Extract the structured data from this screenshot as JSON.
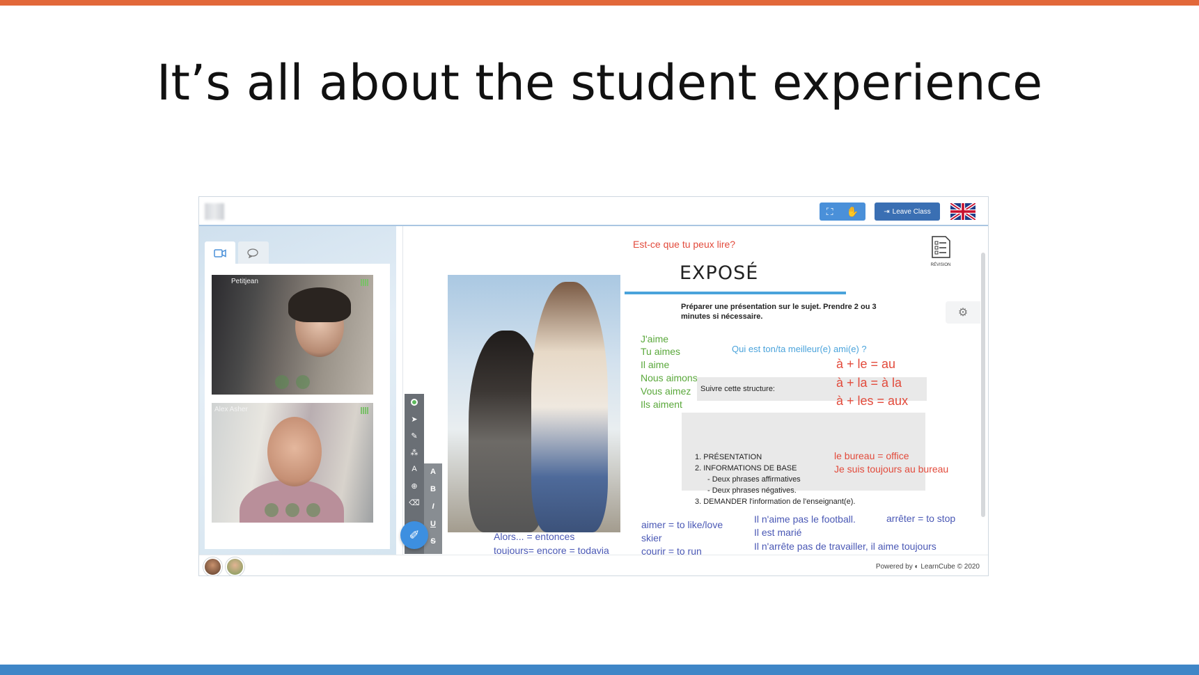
{
  "slide": {
    "title": "It’s all about the student experience",
    "colors": {
      "top_bar": "#e2683a",
      "bottom_bar": "#3f86c7"
    }
  },
  "app": {
    "header": {
      "fullscreen_icon": "fullscreen-icon",
      "hand_icon": "hand-raise-icon",
      "leave_label": "Leave Class",
      "leave_icon": "exit-icon",
      "flag_icon": "uk-flag-icon"
    },
    "left_panel": {
      "tabs": [
        {
          "icon": "video-camera-icon"
        },
        {
          "icon": "chat-bubbles-icon"
        }
      ],
      "participants": [
        {
          "name": "Petitjean"
        },
        {
          "name": "Alex Asher"
        }
      ]
    },
    "lesson": {
      "question": "Est-ce que tu peux lire?",
      "heading": "EXPOSÉ",
      "instruction_line1": "Préparer une présentation sur le sujet. Prendre 2 ou 3",
      "instruction_line2": "minutes si nécessaire.",
      "conjugations": [
        "J'aime",
        "Tu aimes",
        "Il aime",
        "Nous aimons",
        "Vous aimez",
        "Ils aiment"
      ],
      "topic": "Qui est ton/ta meilleur(e) ami(e) ?",
      "contractions": [
        "à + le = au",
        "à + la = à la",
        "à + les = aux"
      ],
      "structure_label": "Suivre cette structure:",
      "structure_items": [
        "1.   PRÉSENTATION",
        "2.   INFORMATIONS DE BASE",
        "- Deux phrases affirmatives",
        "- Deux phrases négatives.",
        "3.   DEMANDER l'information de l'enseignant(e)."
      ],
      "notes_red": [
        "le bureau = office",
        "Je suis toujours au bureau"
      ],
      "notes_blue_left": [
        "Alors... = entonces",
        "toujours= encore = todavia"
      ],
      "notes_blue_mid": [
        "aimer = to like/love",
        "skier",
        "courir = to run"
      ],
      "notes_blue_right": [
        "Il n'aime pas le football.",
        "Il est marié",
        "Il n'arrête pas de travailler, il aime toujours"
      ],
      "note_stop": "arrêter = to stop",
      "revision_label": "RÉVISION"
    },
    "toolbar": {
      "tools": [
        "record-dot-icon",
        "pointer-icon",
        "pen-icon",
        "shapes-icon",
        "text-icon",
        "zoom-icon",
        "eraser-icon"
      ],
      "format": [
        "A",
        "B",
        "I",
        "U",
        "S"
      ],
      "text_tool_label": "A"
    },
    "footer": {
      "powered_by": "Powered by",
      "brand": "LearnCube © 2020"
    }
  }
}
